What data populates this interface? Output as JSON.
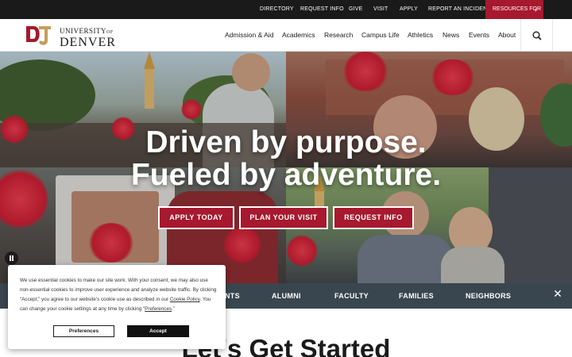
{
  "utility_nav": {
    "directory": "DIRECTORY",
    "request_info": "REQUEST INFO",
    "give": "GIVE",
    "visit": "VISIT",
    "apply": "APPLY",
    "report_incident": "REPORT AN INCIDENT",
    "resources_for": "RESOURCES FOR"
  },
  "logo": {
    "line1": "UNIVERSITY",
    "line1_of": "OF",
    "line2": "DENVER"
  },
  "main_nav": [
    "Admission & Aid",
    "Academics",
    "Research",
    "Campus Life",
    "Athletics",
    "News",
    "Events",
    "About"
  ],
  "hero": {
    "headline_line1": "Driven by purpose.",
    "headline_line2": "Fueled by adventure.",
    "cta": [
      "APPLY TODAY",
      "PLAN YOUR VISIT",
      "REQUEST INFO"
    ]
  },
  "audience_nav": [
    "NTS",
    "ALUMNI",
    "FACULTY",
    "FAMILIES",
    "NEIGHBORS"
  ],
  "section": {
    "lead": "Let's Get ",
    "bold": "Started"
  },
  "cookie": {
    "text_before_link": "We use essential cookies to make our site work. With your consent, we may also use non-essential cookies to improve user experience and analyze website traffic. By clicking “Accept,” you agree to our website's cookie use as described in our ",
    "policy_link": "Cookie Policy",
    "text_mid": ". You can change your cookie settings at any time by clicking “",
    "prefs_link": "Preferences",
    "text_end": ".”",
    "preferences_button": "Preferences",
    "accept_button": "Accept"
  },
  "colors": {
    "brand_crimson": "#a6192e",
    "brand_gold": "#c59e57",
    "utility_bar": "#1a1a1a",
    "audience_bar": "#39464f"
  },
  "icons": {
    "search": "search-icon",
    "close": "close-icon",
    "pause": "pause-icon",
    "chevron": "chevron-right-icon"
  }
}
